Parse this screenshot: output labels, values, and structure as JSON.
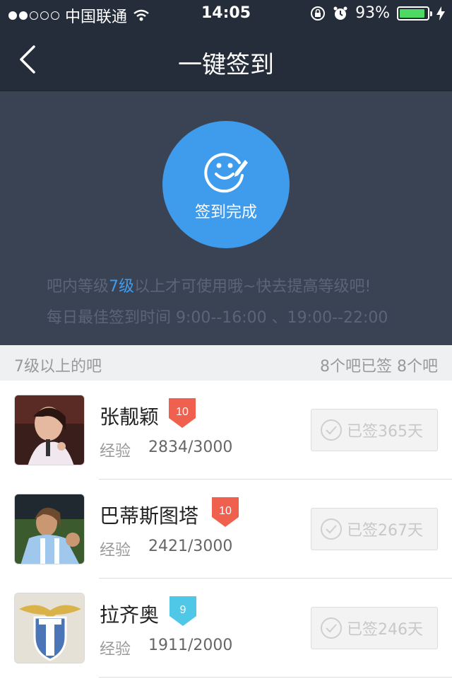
{
  "status_bar": {
    "carrier": "中国联通",
    "time": "14:05",
    "battery": "93%",
    "battery_level": 0.93
  },
  "nav": {
    "title": "一键签到"
  },
  "sign": {
    "button_label": "签到完成",
    "hint_prefix": "吧内等级",
    "hint_level": "7级",
    "hint_suffix": "以上才可使用哦~快去提高等级吧!",
    "time_hint": "每日最佳签到时间  9:00--16:00 、19:00--22:00"
  },
  "section": {
    "left": "7级以上的吧",
    "right": "8个吧已签   8个吧"
  },
  "items": [
    {
      "name": "张靓颖",
      "level": "10",
      "level_color": "#f0604e",
      "exp_label": "经验",
      "exp": "2834/3000",
      "signed": "已签365天"
    },
    {
      "name": "巴蒂斯图塔",
      "level": "10",
      "level_color": "#f0604e",
      "exp_label": "经验",
      "exp": "2421/3000",
      "signed": "已签267天"
    },
    {
      "name": "拉齐奥",
      "level": "9",
      "level_color": "#4fc7e6",
      "exp_label": "经验",
      "exp": "1911/2000",
      "signed": "已签246天"
    }
  ],
  "colors": {
    "nav_bg": "#262d3a",
    "hero_bg": "#394354",
    "accent": "#3f9bec"
  }
}
